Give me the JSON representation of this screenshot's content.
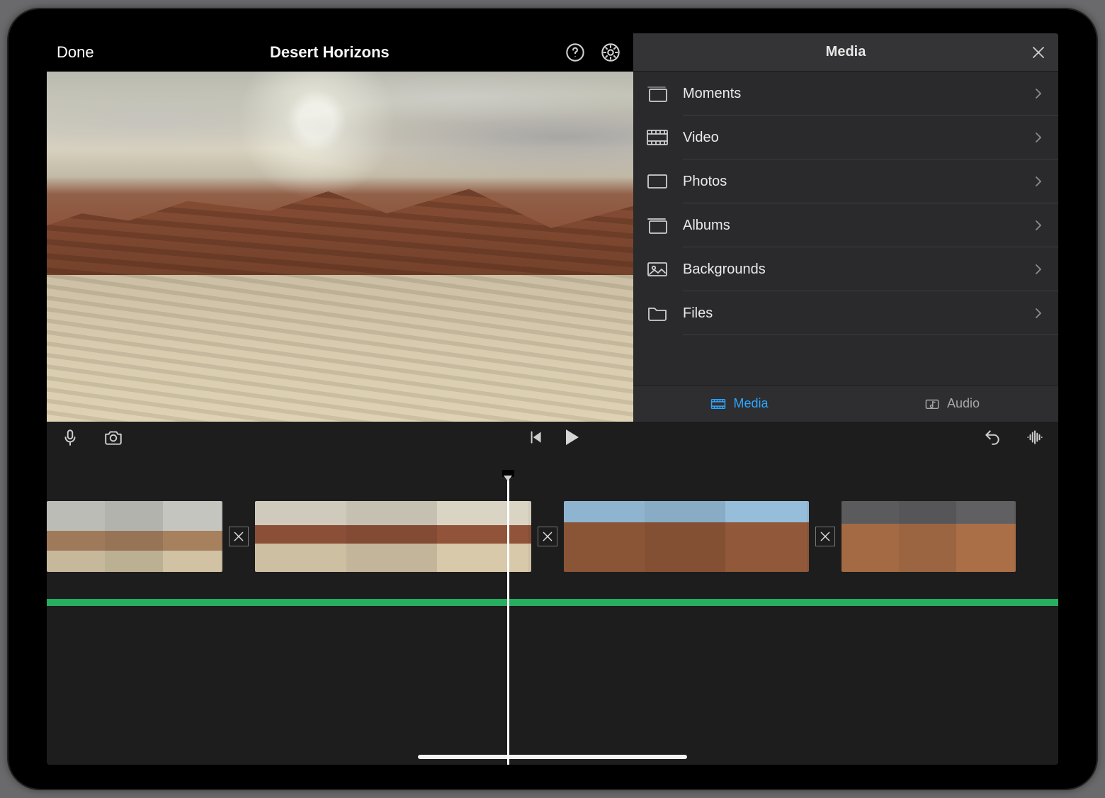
{
  "header": {
    "done_label": "Done",
    "project_title": "Desert Horizons"
  },
  "media_panel": {
    "title": "Media",
    "items": [
      {
        "icon": "moments-icon",
        "label": "Moments"
      },
      {
        "icon": "video-icon",
        "label": "Video"
      },
      {
        "icon": "photos-icon",
        "label": "Photos"
      },
      {
        "icon": "albums-icon",
        "label": "Albums"
      },
      {
        "icon": "backgrounds-icon",
        "label": "Backgrounds"
      },
      {
        "icon": "files-icon",
        "label": "Files"
      }
    ],
    "tabs": {
      "media_label": "Media",
      "audio_label": "Audio",
      "active": "media"
    }
  },
  "timeline": {
    "clips": 4,
    "transitions": 3,
    "audio_track_color": "#27ae60"
  }
}
